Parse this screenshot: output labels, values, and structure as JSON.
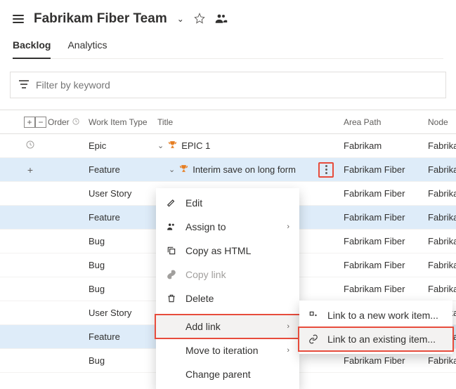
{
  "header": {
    "title": "Fabrikam Fiber Team"
  },
  "tabs": {
    "backlog": "Backlog",
    "analytics": "Analytics"
  },
  "filter": {
    "placeholder": "Filter by keyword"
  },
  "columns": {
    "order": "Order",
    "type": "Work Item Type",
    "title": "Title",
    "area": "Area Path",
    "node": "Node"
  },
  "rows": [
    {
      "type": "Epic",
      "title": "EPIC 1",
      "area": "Fabrikam",
      "node": "Fabrikam",
      "trophy": true,
      "selected": false,
      "expander": true,
      "clock": true
    },
    {
      "type": "Feature",
      "title": "Interim save on long form",
      "area": "Fabrikam Fiber",
      "node": "Fabrikam",
      "trophy": true,
      "selected": true,
      "expander": true,
      "plus": true,
      "more": true,
      "indent": 1
    },
    {
      "type": "User Story",
      "title": "",
      "area": "Fabrikam Fiber",
      "node": "Fabrikam",
      "selected": false
    },
    {
      "type": "Feature",
      "title": "",
      "area": "Fabrikam Fiber",
      "node": "Fabrikam",
      "selected": true
    },
    {
      "type": "Bug",
      "title": "",
      "area": "Fabrikam Fiber",
      "node": "Fabrikam",
      "selected": false
    },
    {
      "type": "Bug",
      "title": "",
      "area": "Fabrikam Fiber",
      "node": "Fabrikam",
      "selected": false
    },
    {
      "type": "Bug",
      "title": "",
      "area": "Fabrikam Fiber",
      "node": "Fabrikam",
      "selected": false
    },
    {
      "type": "User Story",
      "title": "",
      "area": "Fabrikam Fiber",
      "node": "Fabrikam",
      "selected": false
    },
    {
      "type": "Feature",
      "title": "",
      "area": "Fabrikam Fiber",
      "node": "Fabrikam",
      "selected": true
    },
    {
      "type": "Bug",
      "title": "",
      "area": "Fabrikam Fiber",
      "node": "Fabrikam",
      "selected": false
    }
  ],
  "menu": {
    "edit": "Edit",
    "assign": "Assign to",
    "copyhtml": "Copy as HTML",
    "copylink": "Copy link",
    "delete": "Delete",
    "addlink": "Add link",
    "movetoiteration": "Move to iteration",
    "changeparent": "Change parent"
  },
  "submenu": {
    "newitem": "Link to a new work item...",
    "existing": "Link to an existing item..."
  }
}
